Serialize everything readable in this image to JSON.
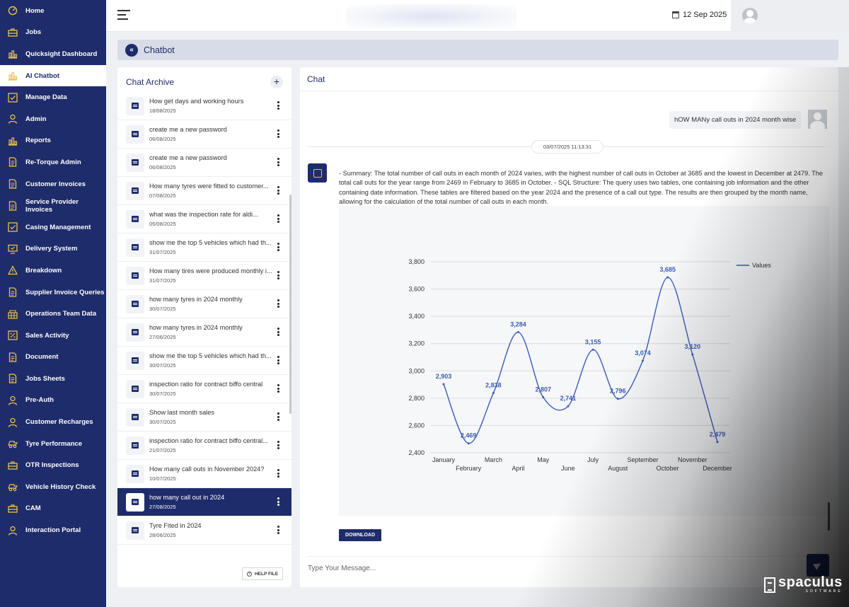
{
  "sidebar": {
    "items": [
      {
        "label": "Home",
        "icon": "dashboard-gauge-icon"
      },
      {
        "label": "Jobs",
        "icon": "briefcase-icon"
      },
      {
        "label": "Quicksight Dashboard",
        "icon": "bar-chart-icon"
      },
      {
        "label": "AI Chatbot",
        "icon": "bar-chart-icon",
        "active": true
      },
      {
        "label": "Manage Data",
        "icon": "checkbox-icon"
      },
      {
        "label": "Admin",
        "icon": "user-icon"
      },
      {
        "label": "Reports",
        "icon": "bar-chart-icon"
      },
      {
        "label": "Re-Torque Admin",
        "icon": "document-icon"
      },
      {
        "label": "Customer Invoices",
        "icon": "document-icon"
      },
      {
        "label": "Service Provider Invoices",
        "icon": "document-icon"
      },
      {
        "label": "Casing Management",
        "icon": "checkbox-icon"
      },
      {
        "label": "Delivery System",
        "icon": "monitor-check-icon"
      },
      {
        "label": "Breakdown",
        "icon": "warning-triangle-icon"
      },
      {
        "label": "Supplier Invoice Queries",
        "icon": "document-icon"
      },
      {
        "label": "Operations Team Data",
        "icon": "grid-data-icon"
      },
      {
        "label": "Sales Activity",
        "icon": "chart-percent-icon"
      },
      {
        "label": "Document",
        "icon": "document-icon"
      },
      {
        "label": "Jobs Sheets",
        "icon": "document-icon"
      },
      {
        "label": "Pre-Auth",
        "icon": "user-icon"
      },
      {
        "label": "Customer Recharges",
        "icon": "user-icon"
      },
      {
        "label": "Tyre Performance",
        "icon": "tyre-truck-icon"
      },
      {
        "label": "OTR Inspections",
        "icon": "briefcase-icon"
      },
      {
        "label": "Vehicle History Check",
        "icon": "tyre-truck-icon"
      },
      {
        "label": "CAM",
        "icon": "briefcase-icon"
      },
      {
        "label": "Interaction Portal",
        "icon": "user-icon"
      }
    ]
  },
  "topbar": {
    "date": "12 Sep 2025"
  },
  "page": {
    "title": "Chatbot"
  },
  "archive": {
    "title": "Chat Archive",
    "help_label": "HELP FILE",
    "items": [
      {
        "q": "How get days and working hours",
        "d": "18/08/2025"
      },
      {
        "q": "create me a new password",
        "d": "06/08/2025"
      },
      {
        "q": "create me a new password",
        "d": "06/08/2025"
      },
      {
        "q": "How many tyres were fitted to customer...",
        "d": "07/08/2025"
      },
      {
        "q": "what was the inspection rate for aldi...",
        "d": "05/08/2025"
      },
      {
        "q": "show me the top 5 vehicles which had th...",
        "d": "31/07/2025"
      },
      {
        "q": "How many tires were produced monthly i...",
        "d": "31/07/2025"
      },
      {
        "q": "how many tyres in 2024 monthly",
        "d": "30/07/2025"
      },
      {
        "q": "how many tyres in 2024 monthly",
        "d": "27/06/2025"
      },
      {
        "q": "show me the top 5 vehicles which had th...",
        "d": "30/07/2025"
      },
      {
        "q": "inspection ratio for contract biffo central",
        "d": "30/07/2025"
      },
      {
        "q": "Show last month sales",
        "d": "30/07/2025"
      },
      {
        "q": "inspection ratio for contract biffo central...",
        "d": "21/07/2025"
      },
      {
        "q": "How many call outs in November 2024?",
        "d": "10/07/2025"
      },
      {
        "q": "how many call out in 2024",
        "d": "27/08/2025",
        "active": true
      },
      {
        "q": "Tyre Fited in 2024",
        "d": "28/06/2025"
      }
    ]
  },
  "chat": {
    "title": "Chat",
    "user_message": "hOW MANy call outs in 2024 month wise",
    "timestamp": "03/07/2025 11:13:31",
    "bot_message": "- Summary: The total number of call outs in each month of 2024 varies, with the highest number of call outs in October at 3685 and the lowest in December at 2479. The total call outs for the year range from 2469 in February to 3685 in October. - SQL Structure: The query uses two tables, one containing job information and the other containing date information. These tables are filtered based on the year 2024 and the presence of a call out type. The results are then grouped by the month name, allowing for the calculation of the total number of call outs in each month.",
    "download_label": "DOWNLOAD",
    "input_placeholder": "Type Your Message..."
  },
  "brand": {
    "name": "spaculus",
    "sub": "SOFTWARE"
  },
  "chart_data": {
    "type": "line",
    "categories": [
      "January",
      "February",
      "March",
      "April",
      "May",
      "June",
      "July",
      "August",
      "September",
      "October",
      "November",
      "December"
    ],
    "series": [
      {
        "name": "Values",
        "values": [
          2903,
          2469,
          2838,
          3284,
          2807,
          2741,
          3155,
          2796,
          3074,
          3685,
          3120,
          2479
        ],
        "color": "#3b5cb8"
      }
    ],
    "yticks": [
      "2,400",
      "2,600",
      "2,800",
      "3,000",
      "3,200",
      "3,400",
      "3,600",
      "3,800"
    ],
    "data_labels": [
      "2,903",
      "2,469",
      "2,838",
      "3,284",
      "2,807",
      "2,741",
      "3,155",
      "2,796",
      "3,074",
      "3,685",
      "3,120",
      "2,479"
    ],
    "ylim": [
      2400,
      3800
    ],
    "grid": true,
    "legend": "top-right"
  }
}
